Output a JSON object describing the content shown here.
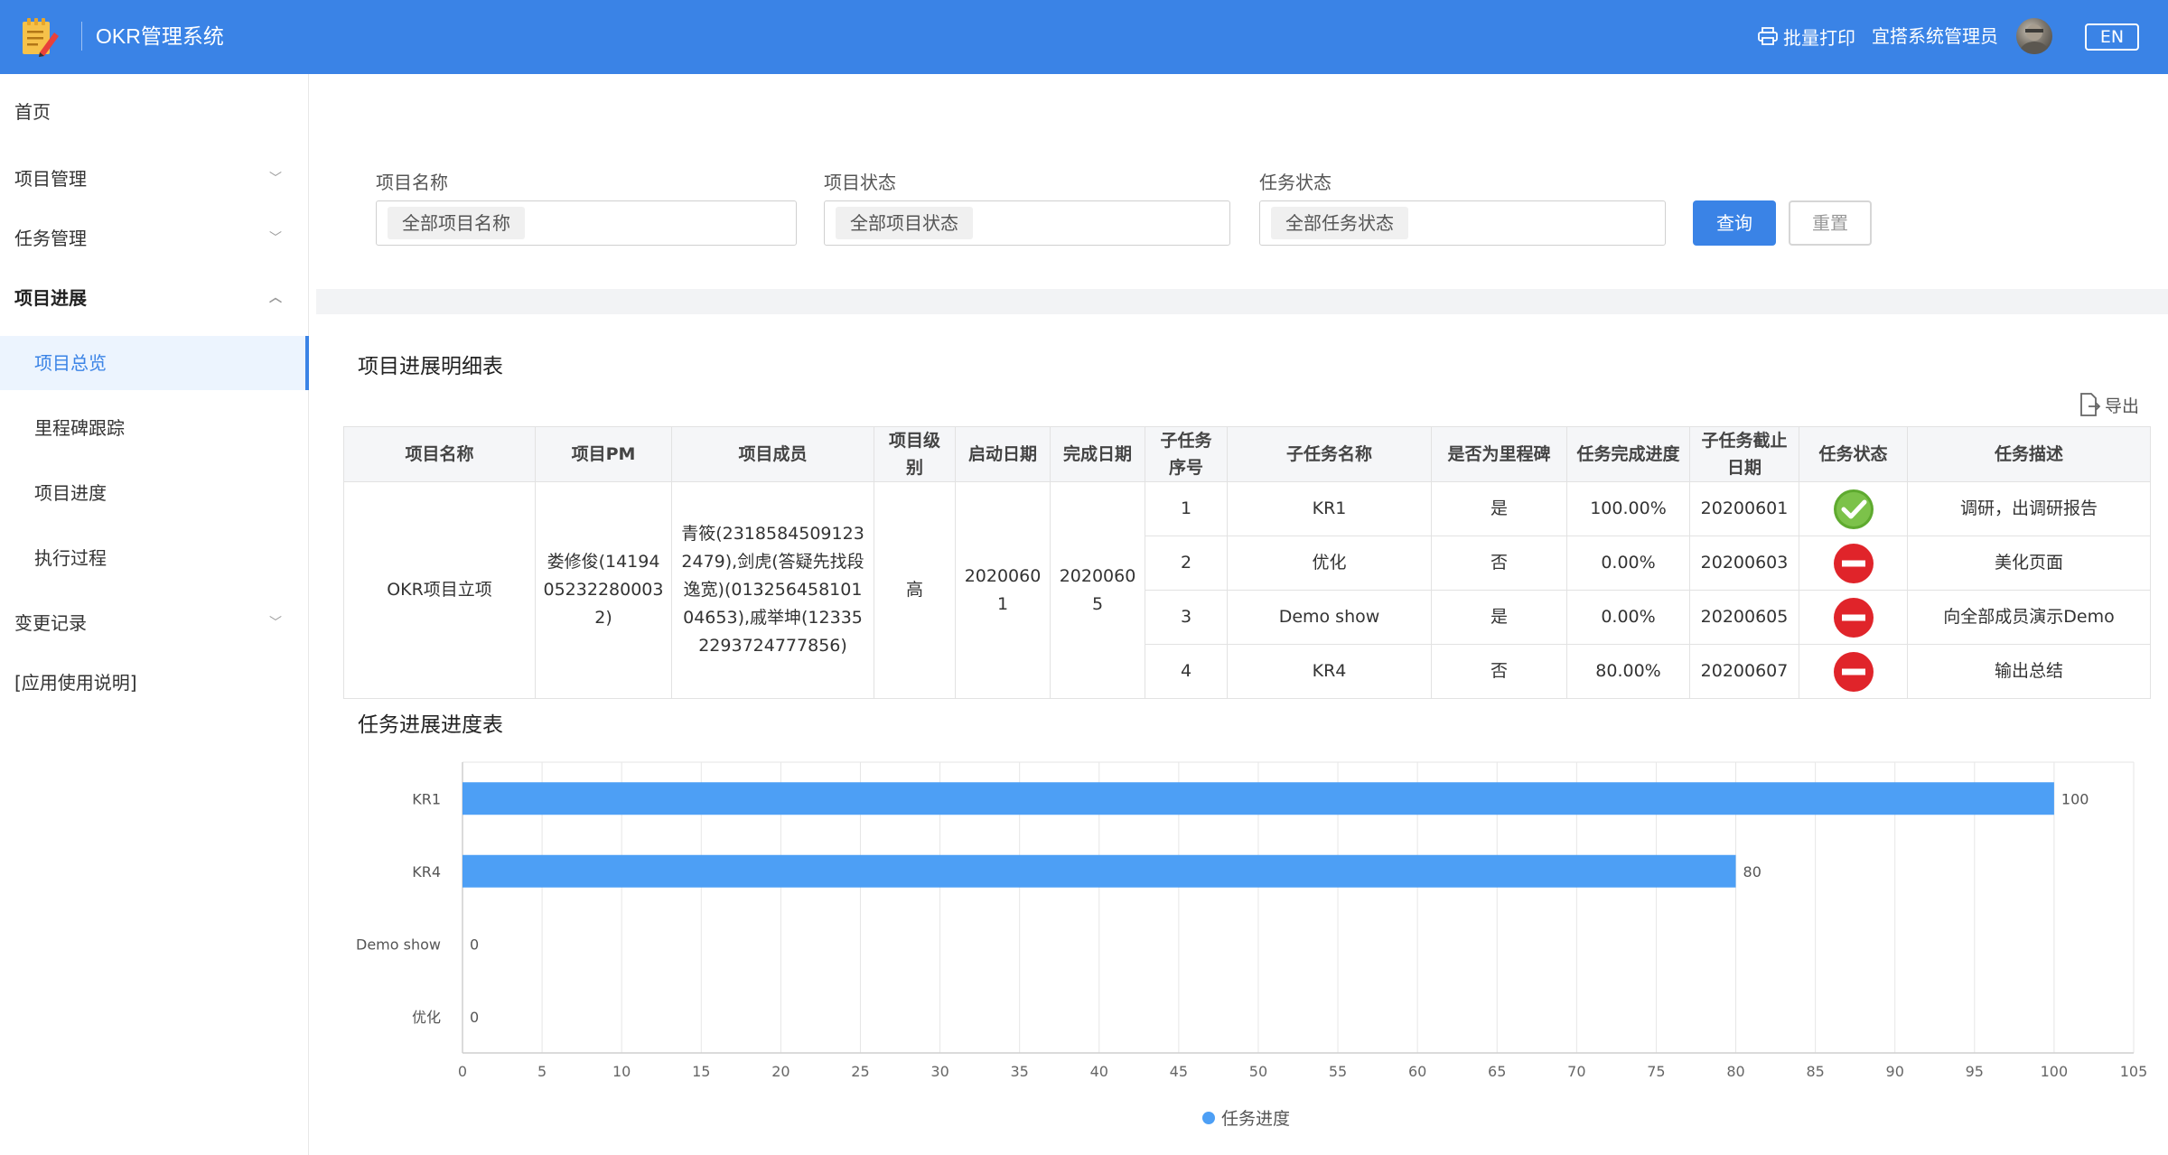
{
  "header": {
    "app_title": "OKR管理系统",
    "print_label": "批量打印",
    "user_name": "宜搭系统管理员",
    "lang_label": "EN",
    "bg_color": "#3a83e6"
  },
  "sidebar": {
    "items": [
      {
        "label": "首页"
      },
      {
        "label": "项目管理",
        "chevron": "﹀"
      },
      {
        "label": "任务管理",
        "chevron": "﹀"
      },
      {
        "label": "项目进展",
        "chevron": "︿"
      },
      {
        "label": "项目总览"
      },
      {
        "label": "里程碑跟踪"
      },
      {
        "label": "项目进度"
      },
      {
        "label": "执行过程"
      },
      {
        "label": "变更记录",
        "chevron": "﹀"
      },
      {
        "label": "[应用使用说明]"
      }
    ]
  },
  "filters": {
    "project_name_label": "项目名称",
    "project_name_value": "全部项目名称",
    "project_status_label": "项目状态",
    "project_status_value": "全部项目状态",
    "task_status_label": "任务状态",
    "task_status_value": "全部任务状态",
    "query_label": "查询",
    "reset_label": "重置"
  },
  "detail": {
    "title": "项目进展明细表",
    "export_label": "导出",
    "columns": [
      "项目名称",
      "项目PM",
      "项目成员",
      "项目级别",
      "启动日期",
      "完成日期",
      "子任务序号",
      "子任务名称",
      "是否为里程碑",
      "任务完成进度",
      "子任务截止日期",
      "任务状态",
      "任务描述"
    ],
    "project": {
      "name": "OKR项目立项",
      "pm": "娄修俊(14194052322800032)",
      "members": "青筱(23185845091232479),剑虎(答疑先找段逸宽)(01325645810104653),戚举坤(123352293724777856)",
      "level": "高",
      "start_date": "20200601",
      "end_date": "20200605"
    },
    "subtasks": [
      {
        "seq": "1",
        "name": "KR1",
        "milestone": "是",
        "progress": "100.00%",
        "progress_color": "#52c41a",
        "deadline": "20200601",
        "status": "done",
        "desc": "调研，出调研报告"
      },
      {
        "seq": "2",
        "name": "优化",
        "milestone": "否",
        "progress": "0.00%",
        "progress_color": "#e0242a",
        "deadline": "20200603",
        "status": "blocked",
        "desc": "美化页面"
      },
      {
        "seq": "3",
        "name": "Demo show",
        "milestone": "是",
        "progress": "0.00%",
        "progress_color": "#e0242a",
        "deadline": "20200605",
        "status": "blocked",
        "desc": "向全部成员演示Demo"
      },
      {
        "seq": "4",
        "name": "KR4",
        "milestone": "否",
        "progress": "80.00%",
        "progress_color": "#e0242a",
        "deadline": "20200607",
        "status": "blocked",
        "desc": "输出总结"
      }
    ]
  },
  "chart_section": {
    "title": "任务进展进度表"
  },
  "chart_data": {
    "type": "bar",
    "orientation": "horizontal",
    "categories": [
      "KR1",
      "KR4",
      "Demo show",
      "优化"
    ],
    "series": [
      {
        "name": "任务进度",
        "values": [
          100,
          80,
          0,
          0
        ],
        "color": "#4d9ff5"
      }
    ],
    "xlim": [
      0,
      105
    ],
    "xticks": [
      0,
      5,
      10,
      15,
      20,
      25,
      30,
      35,
      40,
      45,
      50,
      55,
      60,
      65,
      70,
      75,
      80,
      85,
      90,
      95,
      100,
      105
    ],
    "grid": true,
    "legend_position": "bottom-center"
  }
}
